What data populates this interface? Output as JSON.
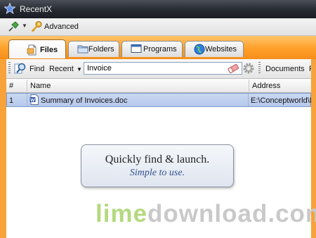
{
  "window": {
    "title": "RecentX",
    "title_icon": "star-icon"
  },
  "toolbar": {
    "advanced_label": "Advanced",
    "pin_icon": "pin-icon",
    "key_icon": "key-icon"
  },
  "tabs": [
    {
      "label": "Files",
      "icon": "file-icon",
      "active": true
    },
    {
      "label": "Folders",
      "icon": "folder-icon",
      "active": false
    },
    {
      "label": "Programs",
      "icon": "window-icon",
      "active": false
    },
    {
      "label": "Websites",
      "icon": "globe-icon",
      "active": false
    }
  ],
  "search": {
    "find_label": "Find",
    "recent_label": "Recent",
    "query": "Invoice",
    "documents_label": "Documents",
    "more_label": "Pi"
  },
  "table": {
    "columns": [
      "#",
      "Name",
      "Address"
    ],
    "rows": [
      {
        "num": "1",
        "name": "Summary of Invoices.doc",
        "address": "E:\\Conceptworld\\Do",
        "selected": true
      }
    ]
  },
  "callout": {
    "line1": "Quickly find & launch.",
    "line2": "Simple to use."
  },
  "watermark": {
    "part1": "lime",
    "part2": "download.com"
  },
  "colors": {
    "accent_orange": "#ff9f28",
    "title_bar": "#262a31",
    "selected_row": "#c9d8f2",
    "watermark_green": "#b5d97f",
    "watermark_gray": "#c9c9c9"
  }
}
